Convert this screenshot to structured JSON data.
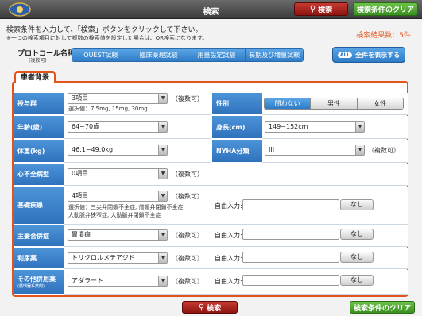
{
  "header": {
    "title": "検索",
    "search_label": "検索",
    "clear_label": "検索条件のクリア"
  },
  "instructions": "検索条件を入力して、「検索」ボタンをクリックして下さい。",
  "note": "※一つの検索項目に対して複数の検索値を設定した場合は、OR検索になります。",
  "result_count": "検索結果数：5件",
  "protocol": {
    "label": "プロトコール名称",
    "sub": "(複数可)",
    "tabs": [
      "QUEST試験",
      "臨床薬理試験",
      "用量設定試験",
      "長期及び増量試験"
    ],
    "show_all": "全件を表示する",
    "all_icon": "ALL"
  },
  "panel_title": "患者背景",
  "form": {
    "dose": {
      "label": "投与群",
      "value": "3項目",
      "hint": "（複数可）",
      "desc": "選択値：7.5mg, 15mg, 30mg"
    },
    "sex": {
      "label": "性別",
      "options": [
        "問わない",
        "男性",
        "女性"
      ],
      "selected": "問わない"
    },
    "age": {
      "label": "年齢(歳)",
      "value": "64~70歳"
    },
    "height": {
      "label": "身長(cm)",
      "value": "149~152cm"
    },
    "weight": {
      "label": "体重(kg)",
      "value": "46.1~49.0kg"
    },
    "nyha": {
      "label": "NYHA分類",
      "value": "III",
      "hint": "（複数可）"
    },
    "hf_type": {
      "label": "心不全病型",
      "value": "0項目",
      "hint": "（複数可）"
    },
    "disease": {
      "label": "基礎疾患",
      "value": "4項目",
      "hint": "（複数可）",
      "desc1": "選択値：三尖弁閉鎖不全症, 僧帽弁閉鎖不全症,",
      "desc2": "大動脈弁狭窄症, 大動脈弁閉鎖不全症",
      "free_label": "自由入力:",
      "none": "なし"
    },
    "complication": {
      "label": "主要合併症",
      "value": "胃潰瘍",
      "hint": "（複数可）",
      "free_label": "自由入力:",
      "none": "なし"
    },
    "diuretic": {
      "label": "利尿薬",
      "value": "トリクロルメチアジド",
      "hint": "（複数可）",
      "free_label": "自由入力:",
      "none": "なし"
    },
    "other_drug": {
      "label": "その他併用薬",
      "sub": "(循環器系薬剤)",
      "value": "アダラート",
      "hint": "（複数可）",
      "free_label": "自由入力:",
      "none": "なし"
    }
  },
  "footer": {
    "search_label": "検索",
    "clear_label": "検索条件のクリア"
  }
}
